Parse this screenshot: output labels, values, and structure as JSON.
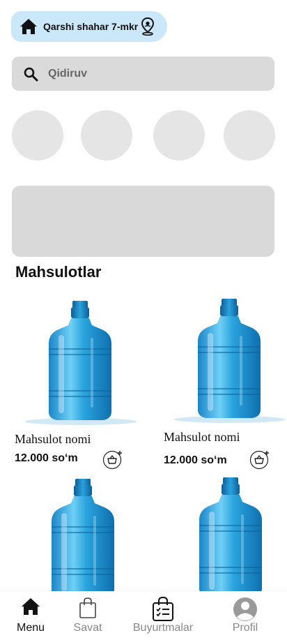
{
  "location": {
    "text": "Qarshi shahar 7-mkr"
  },
  "search": {
    "placeholder": "Qidiruv"
  },
  "products": {
    "title": "Mahsulotlar",
    "items": [
      {
        "name": "Mahsulot nomi",
        "price": "12.000 so‘m"
      },
      {
        "name": "Mahsulot nomi",
        "price": "12.000 so‘m"
      },
      {
        "name": "",
        "price": ""
      },
      {
        "name": "",
        "price": ""
      }
    ]
  },
  "nav": {
    "items": [
      {
        "label": "Menu",
        "icon": "home-icon",
        "active": true
      },
      {
        "label": "Savat",
        "icon": "shopping-bag-icon",
        "active": false
      },
      {
        "label": "Buyurtmalar",
        "icon": "order-list-icon",
        "active": false
      },
      {
        "label": "Profil",
        "icon": "avatar-icon",
        "active": false
      }
    ]
  },
  "colors": {
    "accent_pill": "#cbe8fb",
    "search_bg": "#dadada",
    "placeholder_bg": "#e5e5e5",
    "bottle": "#2a9fd8"
  }
}
